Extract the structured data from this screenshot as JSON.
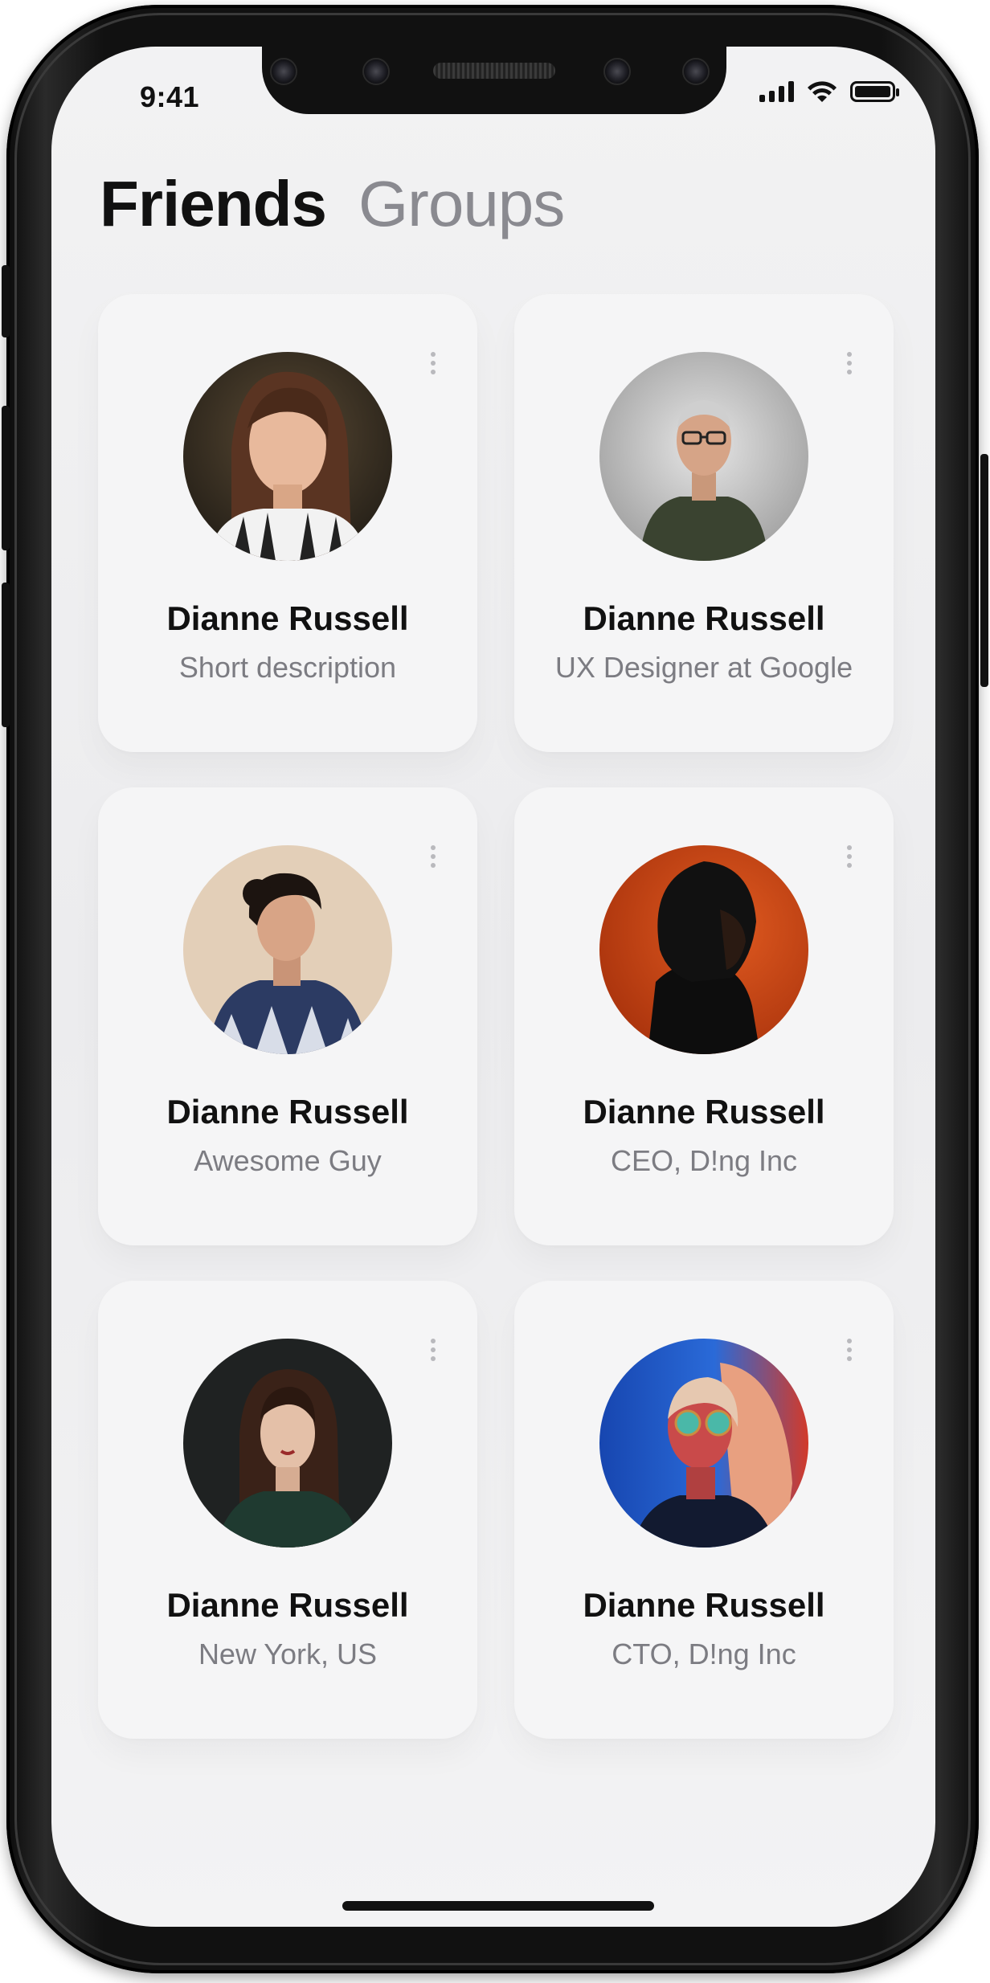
{
  "status_bar": {
    "time": "9:41",
    "signal_icon": "cellular-signal-icon",
    "wifi_icon": "wifi-icon",
    "battery_icon": "battery-icon"
  },
  "tabs": [
    {
      "label": "Friends",
      "selected": true
    },
    {
      "label": "Groups",
      "selected": false
    }
  ],
  "cards": [
    {
      "name": "Dianne Russell",
      "description": "Short description",
      "avatar_icon": "woman-portrait-avatar"
    },
    {
      "name": "Dianne Russell",
      "description": "UX Designer at Google",
      "avatar_icon": "man-portrait-avatar"
    },
    {
      "name": "Dianne Russell",
      "description": "Awesome Guy",
      "avatar_icon": "woman-portrait-avatar"
    },
    {
      "name": "Dianne Russell",
      "description": "CEO, D!ng Inc",
      "avatar_icon": "man-portrait-avatar"
    },
    {
      "name": "Dianne Russell",
      "description": "New York, US",
      "avatar_icon": "woman-portrait-avatar"
    },
    {
      "name": "Dianne Russell",
      "description": "CTO, D!ng Inc",
      "avatar_icon": "woman-portrait-avatar"
    }
  ],
  "colors": {
    "text_primary": "#111111",
    "text_secondary": "#7c7c82",
    "tab_inactive": "#8a8a90",
    "card_bg": "#f5f5f6",
    "screen_bg": "#efeff0"
  }
}
